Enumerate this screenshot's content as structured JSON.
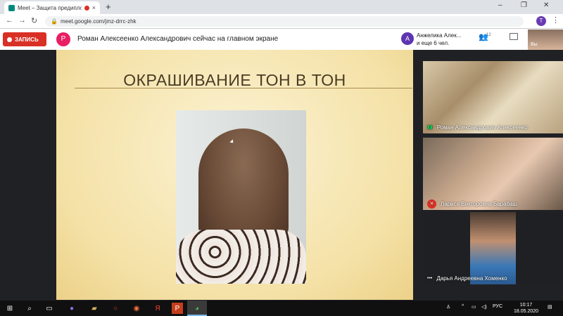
{
  "browser": {
    "tab_title": "Meet – Защита предиплом",
    "tab_close": "×",
    "new_tab": "+",
    "win_min": "–",
    "win_max": "❐",
    "win_close": "✕",
    "url": "meet.google.com/jmz-drrc-zhk",
    "back": "←",
    "forward": "→",
    "reload": "↻",
    "profile_initial": "T",
    "menu": "⋮"
  },
  "meet": {
    "record_label": "ЗАПИСЬ",
    "presenter_initial": "Р",
    "presenter_text": "Роман Алексеенко Александрович сейчас на главном экране",
    "participant_initial": "А",
    "participant_name": "Анжелика Алек...",
    "participant_more": "и еще 6 чел.",
    "people_count": "12",
    "self_label": "Вы"
  },
  "slide": {
    "title": "ОКРАШИВАНИЕ ТОН В ТОН"
  },
  "tiles": [
    {
      "name": "Роман Александрович Алексеенко",
      "speaking": true
    },
    {
      "name": "Лариса Викторовна Барабаш",
      "muted": true
    },
    {
      "name": "Дарья Андреевна Хоменко",
      "speaking": false
    }
  ],
  "taskbar": {
    "lang": "РУС",
    "time": "10:17",
    "date": "18.05.2020"
  },
  "colors": {
    "record_red": "#d93025",
    "presenter_pink": "#e91e63",
    "participant_purple": "#5e35b1",
    "slide_title": "#4a3b24"
  }
}
